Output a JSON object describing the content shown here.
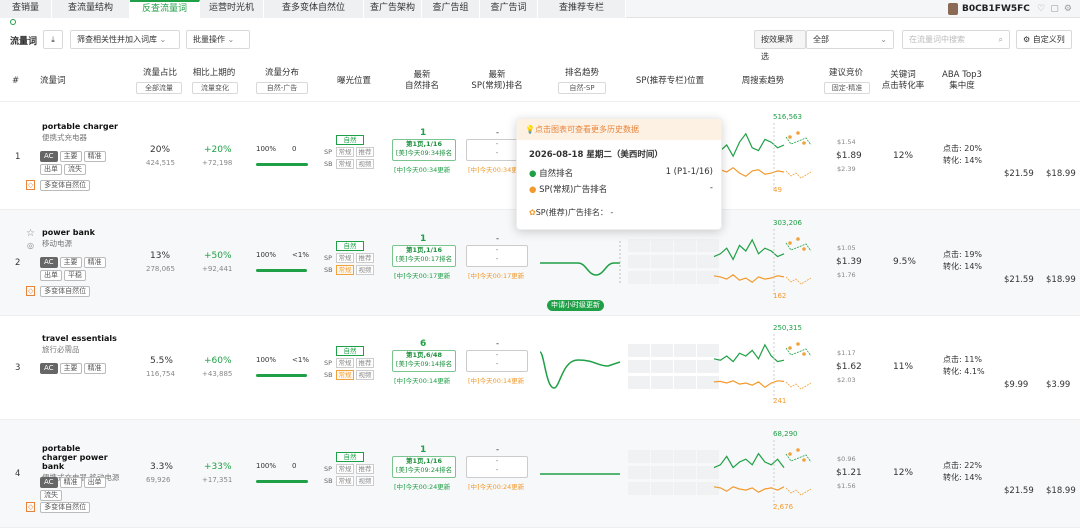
{
  "tabs": [
    {
      "label": "查销量"
    },
    {
      "label": "查流量结构"
    },
    {
      "label": "反查流量词",
      "active": true
    },
    {
      "label": "运营时光机"
    },
    {
      "label": "查多变体自然位"
    },
    {
      "label": "查广告架构"
    },
    {
      "label": "查广告组"
    },
    {
      "label": "查广告词"
    },
    {
      "label": "查推荐专栏"
    }
  ],
  "asin": "B0CB1FW5FC",
  "toolbar": {
    "title": "流量词",
    "filter_label": "筛查相关性并加入词库",
    "batch_label": "批量操作",
    "effect_label": "按效果筛选",
    "effect_value": "全部",
    "search_placeholder": "在流量词中搜索",
    "custom_cols_label": "自定义列"
  },
  "header": {
    "idx": "#",
    "keyword": "流量词",
    "share": "流量占比",
    "share_sel": "全部流量",
    "change": "相比上期的",
    "change_sel": "流量变化",
    "dist": "流量分布",
    "dist_sel": "自然-广告",
    "expo": "曝光位置",
    "nat_rank_1": "最新",
    "nat_rank_2": "自然排名",
    "sp_rank_1": "最新",
    "sp_rank_2": "SP(常规)排名",
    "trend": "排名趋势",
    "trend_sel": "自然-SP",
    "sp_rec": "SP(推荐专栏)位置",
    "weekly": "周搜索趋势",
    "bid": "建议竞价",
    "bid_sel": "固定-精准",
    "cvr_1": "关键词",
    "cvr_2": "点击转化率",
    "aba_1": "ABA Top3",
    "aba_2": "集中度"
  },
  "labels": {
    "natural": "自然",
    "regular": "常规",
    "recommend": "推荐",
    "video": "视频",
    "sp": "SP",
    "sb": "SB",
    "ac": "AC",
    "main": "主要",
    "precise": "精准",
    "out": "出单",
    "loss": "流失",
    "flat": "平稳",
    "variant": "多变体自然位",
    "updated_badge": "申请小时级更新"
  },
  "rows": [
    {
      "idx": "1",
      "kw": "portable charger",
      "kw_cn": "便携式充电器",
      "tags": [
        "AC",
        "主要",
        "精准",
        "出单",
        "流失"
      ],
      "share": "20%",
      "share_num": "424,515",
      "change": "+20%",
      "change_num": "+72,198",
      "dist_left": "100%",
      "dist_right": "0",
      "dist_pct": 100,
      "rank_main": "1",
      "rank_page": "第1页,1/16",
      "rank_time1": "[美]今天09:34排名",
      "rank_time2": "[中]今天00:34更新",
      "ad_main": "-",
      "ad_time": "[中]今天00:34更",
      "peak": "516,563",
      "low": "49",
      "bid_low": "$1.54",
      "bid_mid": "$1.89",
      "bid_high": "$2.39",
      "cvr": "12%",
      "aba_click": "点击: 20%",
      "aba_conv": "转化: 14%",
      "p1": "$21.59",
      "p2": "$18.99"
    },
    {
      "idx": "2",
      "kw": "power bank",
      "kw_cn": "移动电源",
      "tags": [
        "AC",
        "主要",
        "精准",
        "出单",
        "平稳"
      ],
      "share": "13%",
      "share_num": "278,065",
      "change": "+50%",
      "change_num": "+92,441",
      "dist_left": "100%",
      "dist_right": "<1%",
      "dist_pct": 99,
      "rank_main": "1",
      "rank_page": "第1页,1/16",
      "rank_time1": "[美]今天00:17排名",
      "rank_time2": "[中]今天00:17更新",
      "ad_main": "-",
      "ad_time": "[中]今天00:17更新",
      "peak": "303,206",
      "low": "162",
      "bid_low": "$1.05",
      "bid_mid": "$1.39",
      "bid_high": "$1.76",
      "cvr": "9.5%",
      "aba_click": "点击: 19%",
      "aba_conv": "转化: 14%",
      "p1": "$21.59",
      "p2": "$18.99"
    },
    {
      "idx": "3",
      "kw": "travel essentials",
      "kw_cn": "旅行必需品",
      "tags": [
        "AC",
        "主要",
        "精准"
      ],
      "share": "5.5%",
      "share_num": "116,754",
      "change": "+60%",
      "change_num": "+43,885",
      "dist_left": "100%",
      "dist_right": "<1%",
      "dist_pct": 99,
      "rank_main": "6",
      "rank_page": "第1页,6/48",
      "rank_time1": "[美]今天09:14排名",
      "rank_time2": "[中]今天00:14更新",
      "ad_main": "-",
      "ad_time": "[中]今天00:14更新",
      "peak": "250,315",
      "low": "241",
      "bid_low": "$1.17",
      "bid_mid": "$1.62",
      "bid_high": "$2.03",
      "cvr": "11%",
      "aba_click": "点击: 11%",
      "aba_conv": "转化: 4.1%",
      "p1": "$9.99",
      "p2": "$3.99"
    },
    {
      "idx": "4",
      "kw": "portable charger power bank",
      "kw_cn": "便携式充电器 移动电源",
      "tags": [
        "AC",
        "精准",
        "出单",
        "流失"
      ],
      "share": "3.3%",
      "share_num": "69,926",
      "change": "+33%",
      "change_num": "+17,351",
      "dist_left": "100%",
      "dist_right": "0",
      "dist_pct": 100,
      "rank_main": "1",
      "rank_page": "第1页,1/16",
      "rank_time1": "[美]今天09:24排名",
      "rank_time2": "[中]今天00:24更新",
      "ad_main": "-",
      "ad_time": "[中]今天00:24更新",
      "peak": "68,290",
      "low": "2,676",
      "bid_low": "$0.96",
      "bid_mid": "$1.21",
      "bid_high": "$1.56",
      "cvr": "12%",
      "aba_click": "点击: 22%",
      "aba_conv": "转化: 14%",
      "p1": "$21.59",
      "p2": "$18.99"
    }
  ],
  "tooltip": {
    "hint": "点击图表可查看更多历史数据",
    "date": "2026-08-18  星期二（美西时间）",
    "nat_label": "自然排名",
    "nat_value": "1 (P1-1/16)",
    "sp_label": "SP(常规)广告排名",
    "sp_value": "-",
    "rec_label": "SP(推荐)广告排名：",
    "rec_value": "-"
  },
  "colors": {
    "green": "#1fa046",
    "orange": "#f29a2e"
  }
}
